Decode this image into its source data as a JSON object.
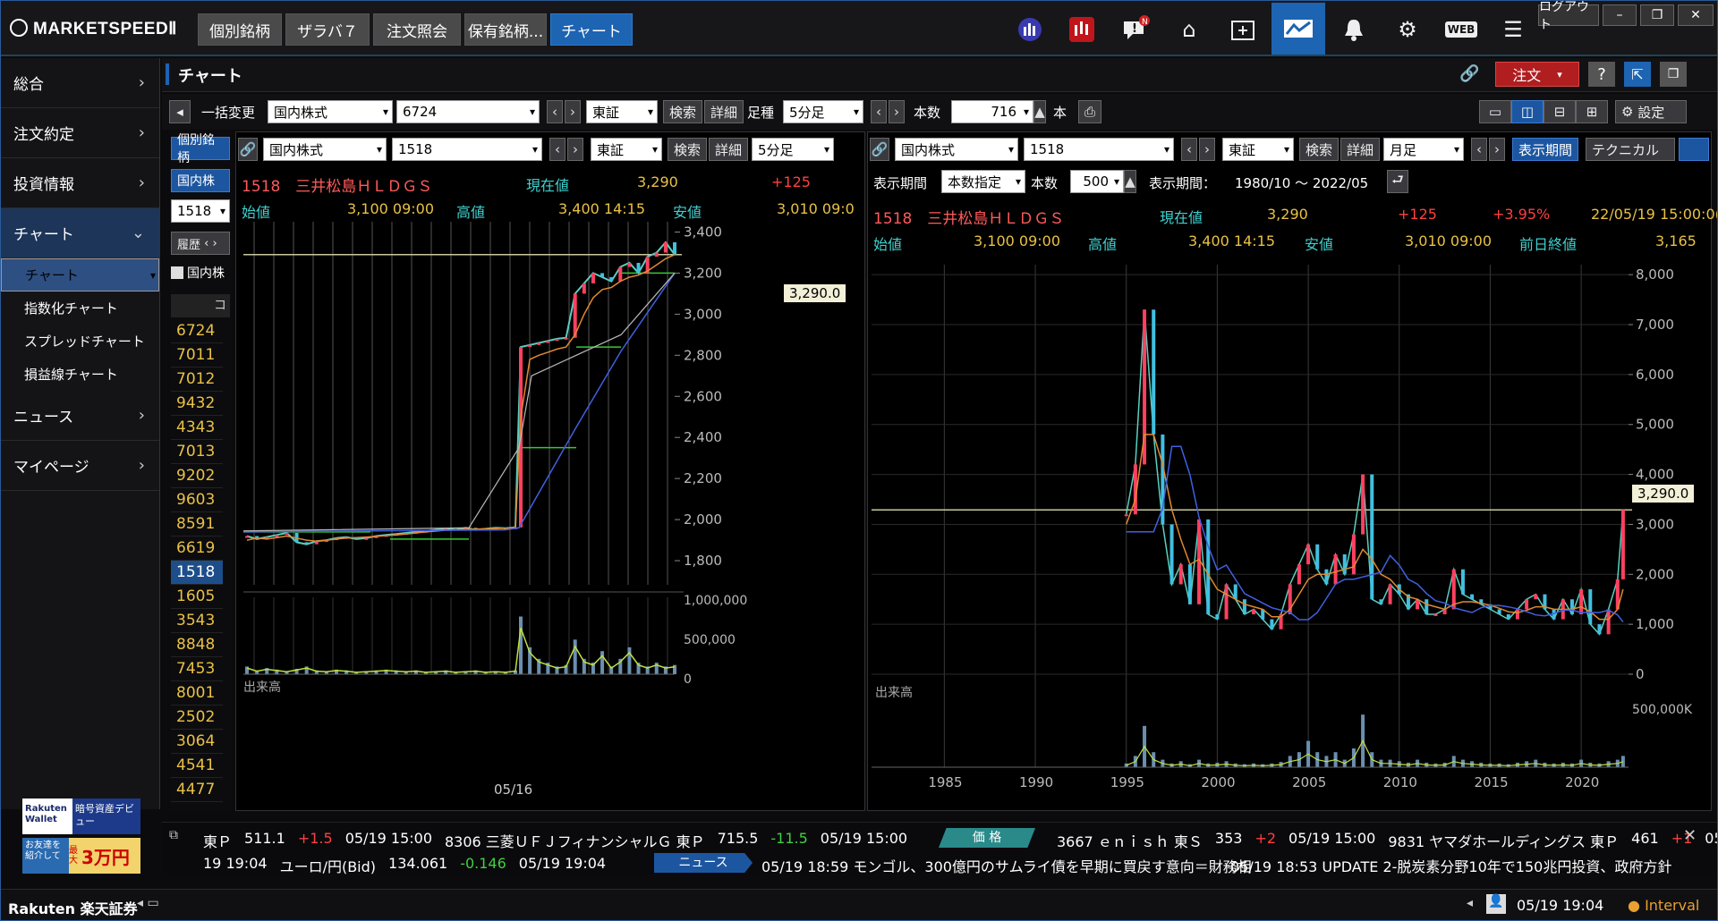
{
  "app": {
    "logo": "MARKETSPEEDⅡ",
    "logout": "ログアウト"
  },
  "nav_tabs": [
    "個別銘柄",
    "ザラバ７",
    "注文照会",
    "保有銘柄...",
    "チャート"
  ],
  "top_icons": [
    "chart-analysis-icon",
    "ranking-icon",
    "notice-icon",
    "home-icon",
    "add-window-icon",
    "chart-window-icon",
    "bell-icon",
    "settings-icon",
    "web-icon",
    "menu-icon"
  ],
  "web_label": "WEB",
  "sidebar": {
    "items": [
      {
        "label": "総合"
      },
      {
        "label": "注文約定"
      },
      {
        "label": "投資情報"
      },
      {
        "label": "チャート"
      },
      {
        "label": "ニュース"
      },
      {
        "label": "マイページ"
      }
    ],
    "sub_items": [
      "チャート",
      "指数化チャート",
      "スプレッドチャート",
      "損益線チャート"
    ]
  },
  "banner": {
    "rakuten_wallet": "Rakuten Wallet",
    "crypto": "暗号資産デビュー",
    "friend": "お友達を紹介して",
    "max": "最大",
    "amount": "3万円"
  },
  "page_title": "チャート",
  "order_button": "注文",
  "toolbar": {
    "bulk_change": "一括変更",
    "market": "国内株式",
    "code": "6724",
    "exchange": "東証",
    "search": "検索",
    "detail": "詳細",
    "ashi_label": "足種",
    "ashi": "5分足",
    "count_label": "本数",
    "count": "716",
    "hon": "本",
    "settings": "設定"
  },
  "list": {
    "tab": "個別銘柄",
    "market_short": "国内株",
    "input": "1518",
    "history": "履歴",
    "checkbox_label": "国内株",
    "col": "コ",
    "codes": [
      "6724",
      "7011",
      "7012",
      "9432",
      "4343",
      "7013",
      "9202",
      "9603",
      "8591",
      "6619",
      "1518",
      "1605",
      "3543",
      "8848",
      "7453",
      "8001",
      "2502",
      "3064",
      "4541",
      "4477"
    ],
    "selected": "1518"
  },
  "left_chart": {
    "market": "国内株式",
    "code": "1518",
    "exchange": "東証",
    "search": "検索",
    "detail": "詳細",
    "ashi": "5分足",
    "name": "1518　三井松島ＨＬＤＧＳ",
    "cur_label": "現在値",
    "cur": "3,290",
    "chg": "+125",
    "open_label": "始値",
    "open": "3,100 09:00",
    "high_label": "高値",
    "high": "3,400 14:15",
    "low_label": "安値",
    "low": "3,010 09:0",
    "price_tag": "3,290.0",
    "volume_label": "出来高",
    "x_label": "05/16"
  },
  "right_chart": {
    "market": "国内株式",
    "code": "1518",
    "exchange": "東証",
    "search": "検索",
    "detail": "詳細",
    "ashi": "月足",
    "period_btn": "表示期間",
    "tech_btn": "テクニカル",
    "period_label": "表示期間",
    "period_mode": "本数指定",
    "count_label": "本数",
    "count": "500",
    "range_label": "表示期間：",
    "range": "1980/10 〜 2022/05",
    "name": "1518　三井松島ＨＬＤＧＳ",
    "cur_label": "現在値",
    "cur": "3,290",
    "chg": "+125",
    "pct": "+3.95%",
    "datetime": "22/05/19 15:00:0(",
    "open_label": "始値",
    "open": "3,100 09:00",
    "high_label": "高値",
    "high": "3,400 14:15",
    "low_label": "安値",
    "low": "3,010 09:00",
    "prev_label": "前日終値",
    "prev": "3,165",
    "price_tag": "3,290.0",
    "volume_label": "出来高",
    "vol_tick": "500,000K"
  },
  "chart_data": [
    {
      "type": "line",
      "title": "1518 三井松島HLDGS 5分足",
      "x": [
        "05/16"
      ],
      "yticks": [
        1800,
        2000,
        2200,
        2400,
        2600,
        2800,
        3000,
        3200,
        3400
      ],
      "ylim": [
        1700,
        3450
      ],
      "vol_ticks": [
        "1,000,000",
        "500,000",
        "0"
      ],
      "close": [
        1920,
        1905,
        1915,
        1925,
        1935,
        1890,
        1880,
        1895,
        1900,
        1910,
        1915,
        1905,
        1910,
        1920,
        1925,
        1930,
        1935,
        1940,
        1945,
        1950,
        1955,
        1950,
        1960,
        1950,
        1955,
        1960,
        1958,
        1962,
        2840,
        2850,
        2860,
        2870,
        2880,
        2885,
        3100,
        3150,
        3200,
        3180,
        3160,
        3230,
        3250,
        3200,
        3280,
        3300,
        3350,
        3290
      ],
      "ma_short": [
        1900,
        1910,
        1905,
        1912,
        1920,
        1910,
        1900,
        1895,
        1900,
        1905,
        1910,
        1912,
        1915,
        1918,
        1922,
        1925,
        1930,
        1935,
        1940,
        1944,
        1948,
        1950,
        1952,
        1954,
        1955,
        1956,
        1958,
        1960,
        2500,
        2780,
        2800,
        2815,
        2830,
        2840,
        2900,
        3000,
        3080,
        3120,
        3130,
        3160,
        3180,
        3190,
        3210,
        3240,
        3270,
        3290
      ],
      "volume": [
        0.1,
        0.05,
        0.08,
        0.06,
        0.04,
        0.07,
        0.1,
        0.05,
        0.04,
        0.06,
        0.05,
        0.03,
        0.04,
        0.05,
        0.06,
        0.05,
        0.04,
        0.05,
        0.03,
        0.04,
        0.05,
        0.03,
        0.04,
        0.05,
        0.03,
        0.04,
        0.03,
        0.05,
        0.75,
        0.35,
        0.2,
        0.15,
        0.1,
        0.12,
        0.45,
        0.2,
        0.15,
        0.3,
        0.1,
        0.2,
        0.35,
        0.15,
        0.1,
        0.15,
        0.1,
        0.12
      ]
    },
    {
      "type": "line",
      "title": "1518 三井松島HLDGS 月足",
      "x": [
        1985,
        1990,
        1995,
        2000,
        2005,
        2010,
        2015,
        2020
      ],
      "yticks": [
        0,
        1000,
        2000,
        3000,
        4000,
        5000,
        6000,
        7000,
        8000
      ],
      "ylim": [
        0,
        8200
      ],
      "vol_ticks": [
        "500,000K"
      ],
      "years": [
        1995,
        1995.5,
        1996,
        1996.5,
        1997,
        1997.5,
        1998,
        1998.5,
        1999,
        1999.5,
        2000,
        2000.5,
        2001,
        2001.5,
        2002,
        2002.5,
        2003,
        2003.5,
        2004,
        2004.5,
        2005,
        2005.5,
        2006,
        2006.5,
        2007,
        2007.5,
        2008,
        2008.5,
        2009,
        2009.5,
        2010,
        2010.5,
        2011,
        2011.5,
        2012,
        2012.5,
        2013,
        2013.5,
        2014,
        2014.5,
        2015,
        2015.5,
        2016,
        2016.5,
        2017,
        2017.5,
        2018,
        2018.5,
        2019,
        2019.5,
        2020,
        2020.5,
        2021,
        2021.5,
        2022,
        2022.3
      ],
      "close": [
        3200,
        4200,
        7300,
        4800,
        3000,
        1800,
        2200,
        1400,
        3100,
        1200,
        1100,
        1800,
        1500,
        1200,
        1300,
        1100,
        900,
        1200,
        1800,
        2200,
        2600,
        2100,
        1800,
        2400,
        2000,
        2800,
        4000,
        1500,
        1400,
        1800,
        1600,
        1300,
        1500,
        1200,
        1200,
        1300,
        2100,
        1600,
        1500,
        1400,
        1300,
        1200,
        1100,
        1300,
        1500,
        1600,
        1300,
        1100,
        1500,
        1200,
        1700,
        1000,
        800,
        1300,
        1900,
        3290
      ],
      "ma": [
        3000,
        3500,
        4800,
        4800,
        4200,
        3300,
        2700,
        2200,
        2300,
        2000,
        1700,
        1600,
        1500,
        1400,
        1350,
        1300,
        1150,
        1150,
        1300,
        1600,
        1900,
        2000,
        2000,
        2050,
        2100,
        2150,
        2500,
        2300,
        2000,
        1900,
        1700,
        1550,
        1500,
        1400,
        1350,
        1300,
        1400,
        1450,
        1450,
        1420,
        1380,
        1320,
        1250,
        1230,
        1280,
        1350,
        1350,
        1300,
        1300,
        1300,
        1350,
        1250,
        1100,
        1100,
        1300,
        1700
      ],
      "volume": [
        0.05,
        0.15,
        0.55,
        0.2,
        0.1,
        0.05,
        0.08,
        0.04,
        0.1,
        0.05,
        0.06,
        0.08,
        0.05,
        0.04,
        0.05,
        0.04,
        0.05,
        0.07,
        0.15,
        0.2,
        0.35,
        0.2,
        0.15,
        0.2,
        0.1,
        0.25,
        0.7,
        0.2,
        0.1,
        0.1,
        0.08,
        0.06,
        0.1,
        0.06,
        0.05,
        0.06,
        0.15,
        0.1,
        0.08,
        0.06,
        0.05,
        0.05,
        0.04,
        0.06,
        0.08,
        0.1,
        0.06,
        0.05,
        0.06,
        0.05,
        0.1,
        0.06,
        0.05,
        0.08,
        0.1,
        0.15
      ]
    }
  ],
  "ticker": {
    "row1": [
      {
        "t": "東Ｐ",
        "c": "#fff"
      },
      {
        "t": "511.1",
        "c": "#fff"
      },
      {
        "t": "+1.5",
        "c": "#ff4040"
      },
      {
        "t": "05/19 15:00",
        "c": "#fff"
      },
      {
        "t": "8306 三菱ＵＦＪフィナンシャルＧ 東Ｐ",
        "c": "#fff"
      },
      {
        "t": "715.5",
        "c": "#fff"
      },
      {
        "t": "-11.5",
        "c": "#40d040"
      },
      {
        "t": "05/19 15:00",
        "c": "#fff"
      }
    ],
    "price_tag": "価 格",
    "row1b": [
      {
        "t": "3667 ｅｎｉｓｈ 東Ｓ",
        "c": "#fff"
      },
      {
        "t": "353",
        "c": "#fff"
      },
      {
        "t": "+2",
        "c": "#ff4040"
      },
      {
        "t": "05/19 15:00",
        "c": "#fff"
      },
      {
        "t": "9831 ヤマダホールディングス 東Ｐ",
        "c": "#fff"
      },
      {
        "t": "461",
        "c": "#fff"
      },
      {
        "t": "+1",
        "c": "#ff4040"
      },
      {
        "t": "05",
        "c": "#fff"
      }
    ],
    "row2a": [
      {
        "t": "19 19:04",
        "c": "#fff"
      },
      {
        "t": "ユーロ/円(Bid)",
        "c": "#fff"
      },
      {
        "t": "134.061",
        "c": "#fff"
      },
      {
        "t": "-0.146",
        "c": "#40d040"
      },
      {
        "t": "05/19 19:04",
        "c": "#fff"
      }
    ],
    "news_tag": "ニュース",
    "news": [
      "05/19 18:59 モンゴル、300億円のサムライ債を早期に買戻す意向＝財務相",
      "05/19 18:53 UPDATE 2-脱炭素分野10年で150兆円投資、政府方針"
    ]
  },
  "status": {
    "brand": "Rakuten 楽天証券",
    "time": "05/19 19:04",
    "interval": "Interval"
  },
  "colors": {
    "accent": "#1d64b2",
    "up": "#ff4040",
    "down": "#40d040",
    "price_line": "#c8c8a0",
    "yellow": "#e9c146"
  }
}
